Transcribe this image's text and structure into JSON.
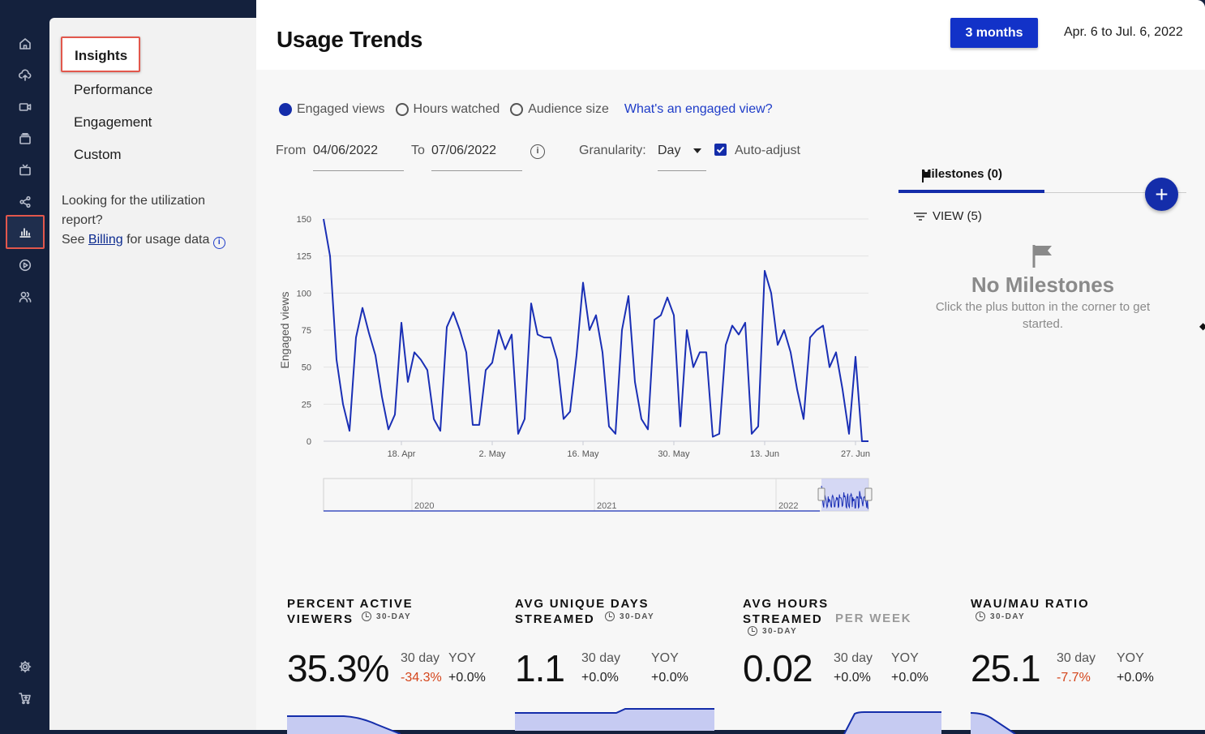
{
  "subnav": {
    "items": [
      "Insights",
      "Performance",
      "Engagement",
      "Custom"
    ],
    "active": "Insights",
    "note_line1": "Looking for the utilization report?",
    "note_see": "See",
    "note_link": "Billing",
    "note_tail": "for usage data"
  },
  "rail": {
    "icons": [
      "home-icon",
      "upload-icon",
      "video-icon",
      "library-icon",
      "tv-icon",
      "share-icon",
      "analytics-icon",
      "play-circle-icon",
      "users-icon",
      "settings-icon",
      "cart-icon"
    ],
    "active": "analytics-icon"
  },
  "header": {
    "title": "Usage Trends",
    "range_button": "3 months",
    "range_text": "Apr. 6 to Jul. 6, 2022"
  },
  "metric_selector": {
    "options": [
      "Engaged views",
      "Hours watched",
      "Audience size"
    ],
    "selected": "Engaged views",
    "help_link": "What's an engaged view?"
  },
  "filters": {
    "from_label": "From",
    "from_value": "04/06/2022",
    "to_label": "To",
    "to_value": "07/06/2022",
    "granularity_label": "Granularity:",
    "granularity_value": "Day",
    "auto_adjust_label": "Auto-adjust",
    "auto_adjust_checked": true
  },
  "chart_data": {
    "type": "line",
    "ylabel": "Engaged views",
    "ylim": [
      0,
      150
    ],
    "yticks": [
      0,
      25,
      50,
      75,
      100,
      125,
      150
    ],
    "xtick_labels": [
      "18. Apr",
      "2. May",
      "16. May",
      "30. May",
      "13. Jun",
      "27. Jun"
    ],
    "xtick_days": [
      12,
      26,
      40,
      54,
      68,
      82
    ],
    "grid": true,
    "color": "#1a2fb5",
    "series": [
      {
        "values": [
          150,
          125,
          55,
          25,
          7,
          70,
          90,
          73,
          58,
          30,
          8,
          18,
          80,
          40,
          60,
          55,
          48,
          15,
          7,
          77,
          87,
          75,
          60,
          11,
          11,
          48,
          53,
          75,
          62,
          72,
          5,
          15,
          93,
          72,
          70,
          70,
          55,
          15,
          20,
          58,
          107,
          75,
          85,
          60,
          10,
          5,
          75,
          98,
          40,
          15,
          8,
          82,
          85,
          97,
          85,
          10,
          75,
          50,
          60,
          60,
          3,
          5,
          65,
          78,
          72,
          80,
          5,
          10,
          115,
          100,
          65,
          75,
          60,
          35,
          15,
          70,
          75,
          78,
          50,
          60,
          35,
          5,
          57,
          0,
          0
        ],
        "x_start_day": 0
      }
    ],
    "navigator": {
      "year_labels": [
        "2020",
        "2021",
        "2022"
      ]
    }
  },
  "milestones": {
    "tab_label": "Milestones (0)",
    "view_label": "VIEW (5)",
    "empty_title": "No Milestones",
    "empty_text": "Click the plus button in the corner to get started.",
    "add_label": "+"
  },
  "kpis": [
    {
      "title": "PERCENT ACTIVE VIEWERS",
      "badge": "30-DAY",
      "value": "35.3%",
      "col1_label": "30 day",
      "col1_value": "-34.3%",
      "col1_negative": true,
      "col2_label": "YOY",
      "col2_value": "+0.0%"
    },
    {
      "title": "AVG UNIQUE DAYS STREAMED",
      "badge": "30-DAY",
      "value": "1.1",
      "col1_label": "30 day",
      "col1_value": "+0.0%",
      "col1_negative": false,
      "col2_label": "YOY",
      "col2_value": "+0.0%"
    },
    {
      "title": "AVG HOURS STREAMED",
      "title_suffix": "PER WEEK",
      "badge": "30-DAY",
      "value": "0.02",
      "col1_label": "30 day",
      "col1_value": "+0.0%",
      "col1_negative": false,
      "col2_label": "YOY",
      "col2_value": "+0.0%"
    },
    {
      "title": "WAU/MAU RATIO",
      "badge": "30-DAY",
      "value": "25.1",
      "col1_label": "30 day",
      "col1_value": "-7.7%",
      "col1_negative": true,
      "col2_label": "YOY",
      "col2_value": "+0.0%"
    }
  ]
}
